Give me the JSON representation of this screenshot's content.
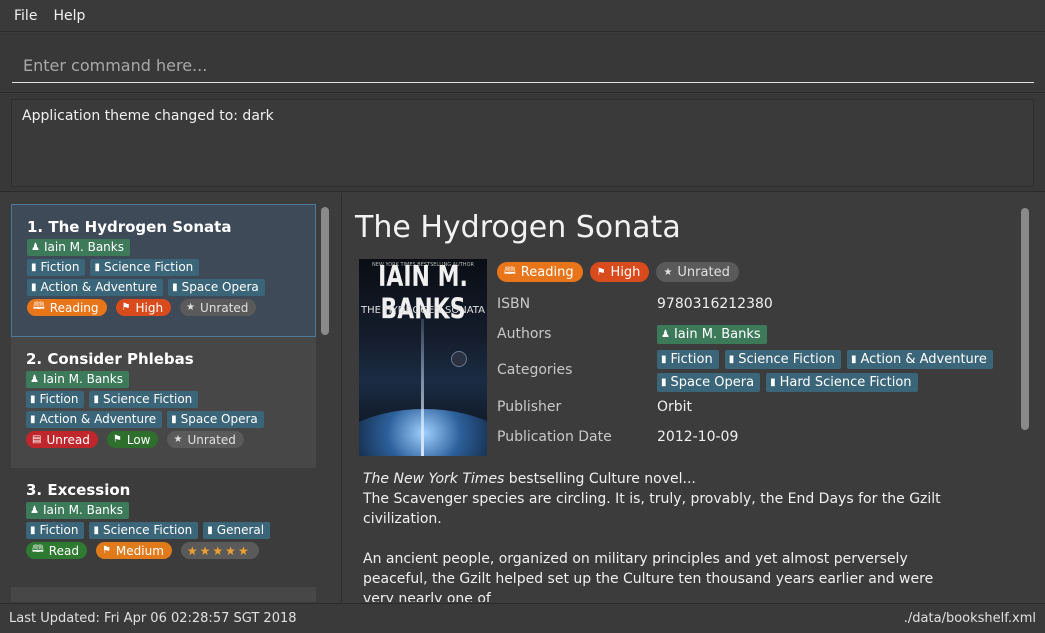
{
  "menu": {
    "file": "File",
    "help": "Help"
  },
  "command": {
    "placeholder": "Enter command here..."
  },
  "result": {
    "message": "Application theme changed to: dark"
  },
  "books": [
    {
      "title": "1. The Hydrogen Sonata",
      "author": "Iain M. Banks",
      "categories": [
        "Fiction",
        "Science Fiction",
        "Action & Adventure",
        "Space Opera"
      ],
      "status": "Reading",
      "priority": "High",
      "rating": "Unrated"
    },
    {
      "title": "2. Consider Phlebas",
      "author": "Iain M. Banks",
      "categories": [
        "Fiction",
        "Science Fiction",
        "Action & Adventure",
        "Space Opera"
      ],
      "status": "Unread",
      "priority": "Low",
      "rating": "Unrated"
    },
    {
      "title": "3. Excession",
      "author": "Iain M. Banks",
      "categories": [
        "Fiction",
        "Science Fiction",
        "General"
      ],
      "status": "Read",
      "priority": "Medium",
      "rating": "★★★★★"
    }
  ],
  "details": {
    "title": "The Hydrogen Sonata",
    "cover": {
      "author": "IAIN M. BANKS",
      "title": "THE HYDROGEN SONATA",
      "blurb": "NEW YORK TIMES BESTSELLING AUTHOR"
    },
    "status": "Reading",
    "priority": "High",
    "rating": "Unrated",
    "labels": {
      "isbn": "ISBN",
      "authors": "Authors",
      "categories": "Categories",
      "publisher": "Publisher",
      "publication_date": "Publication Date"
    },
    "isbn": "9780316212380",
    "authors": [
      "Iain M. Banks"
    ],
    "categories": [
      "Fiction",
      "Science Fiction",
      "Action & Adventure",
      "Space Opera",
      "Hard Science Fiction"
    ],
    "publisher": "Orbit",
    "publication_date": "2012-10-09",
    "description": {
      "line1_italic": "The New York Times",
      "line1_rest": " bestselling Culture novel...",
      "para1": "The Scavenger species are circling. It is, truly, provably, the End Days for the Gzilt civilization.",
      "para2": "An ancient people, organized on military principles and yet almost perversely peaceful, the Gzilt helped set up the Culture ten thousand years earlier and were very nearly one of"
    }
  },
  "status": {
    "last_updated": "Last Updated: Fri Apr 06 02:28:57 SGT 2018",
    "path": "./data/bookshelf.xml"
  },
  "colors": {
    "accent_selected": "#4d7a99",
    "author_tag": "#3d7a5a",
    "category_tag": "#3b6578",
    "reading": "#e8751a",
    "high": "#d94b1c",
    "unread": "#c0272d",
    "low": "#2e6f2e",
    "read": "#2e7a30",
    "medium": "#e07a1a"
  },
  "icons": {
    "author": "person-icon",
    "category": "bookmark-icon",
    "reading": "open-book-icon",
    "priority": "flag-icon",
    "rating": "star-icon",
    "unread": "closed-book-icon",
    "read": "open-book-icon"
  }
}
